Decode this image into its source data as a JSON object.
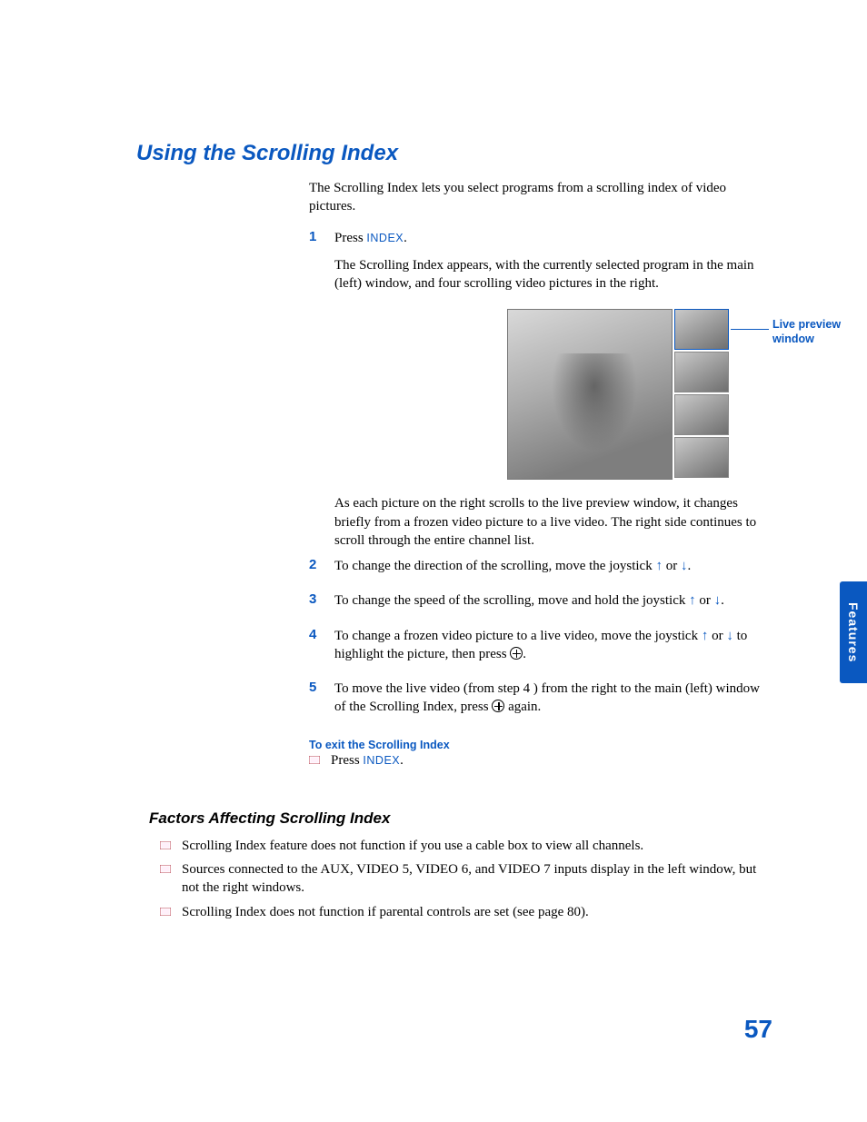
{
  "title": "Using the Scrolling Index",
  "intro": "The Scrolling Index lets you select programs from a scrolling index of video pictures.",
  "steps": [
    {
      "num": "1",
      "fragments": [
        "Press ",
        {
          "cmd": "INDEX"
        },
        "."
      ],
      "after": "The Scrolling Index appears, with the currently selected program in the main (left) window, and four scrolling video pictures in the right."
    },
    {
      "num": "2",
      "fragments": [
        "To change the direction of the scrolling, move the joystick ",
        {
          "arrow": "up"
        },
        " or ",
        {
          "arrow": "down"
        },
        "."
      ]
    },
    {
      "num": "3",
      "fragments": [
        "To change the speed of the scrolling, move and hold the joystick ",
        {
          "arrow": "up"
        },
        " or ",
        {
          "arrow": "down"
        },
        "."
      ]
    },
    {
      "num": "4",
      "fragments": [
        "To change a frozen video picture to a live video, move the joystick ",
        {
          "arrow": "up"
        },
        " or ",
        {
          "arrow": "down"
        },
        " to highlight the picture, then press ",
        {
          "press": true
        },
        "."
      ]
    },
    {
      "num": "5",
      "fragments": [
        "To move the live video (from step 4 ) from the right to the main (left) window of the Scrolling Index, press ",
        {
          "press": true
        },
        " again."
      ]
    }
  ],
  "image_callout": "Live preview window",
  "after_image": "As each picture on the right scrolls to the live preview window, it changes briefly from a frozen video picture to a live video. The right side continues to scroll through the entire channel list.",
  "sub_heading": "To exit the Scrolling Index",
  "sub_bullet": [
    "Press ",
    {
      "cmd": "INDEX"
    },
    "."
  ],
  "h2": "Factors Affecting Scrolling Index",
  "factors": [
    "Scrolling Index feature does not function if you use a cable box to view all channels.",
    "Sources connected to the AUX, VIDEO 5, VIDEO 6, and VIDEO 7 inputs display in the left window, but not the right windows.",
    "Scrolling Index does not function if parental controls are set (see page 80)."
  ],
  "side_tab": "Features",
  "page_number": "57"
}
